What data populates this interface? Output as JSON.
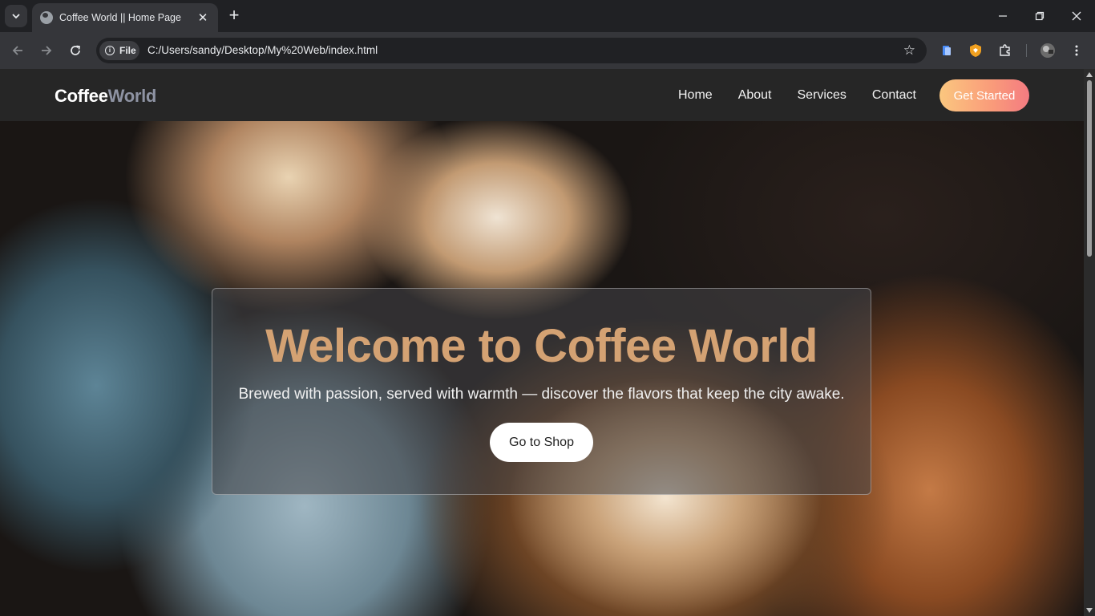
{
  "browser": {
    "tab_title": "Coffee World || Home Page",
    "new_tab_icon": "plus-icon",
    "address_chip": "File",
    "url": "C:/Users/sandy/Desktop/My%20Web/index.html"
  },
  "site": {
    "brand_part1": "Coffee",
    "brand_part2": "World",
    "nav": [
      "Home",
      "About",
      "Services",
      "Contact"
    ],
    "cta_label": "Get Started",
    "colors": {
      "nav_bg": "#262626",
      "brand_accent": "#8e93a3",
      "cta_gradient_start": "#fbc77f",
      "cta_gradient_end": "#f47b81",
      "hero_title": "#d4a273"
    }
  },
  "hero": {
    "title": "Welcome to Coffee World",
    "subtitle": "Brewed with passion, served with warmth — discover the flavors that keep the city awake.",
    "button_label": "Go to Shop"
  }
}
